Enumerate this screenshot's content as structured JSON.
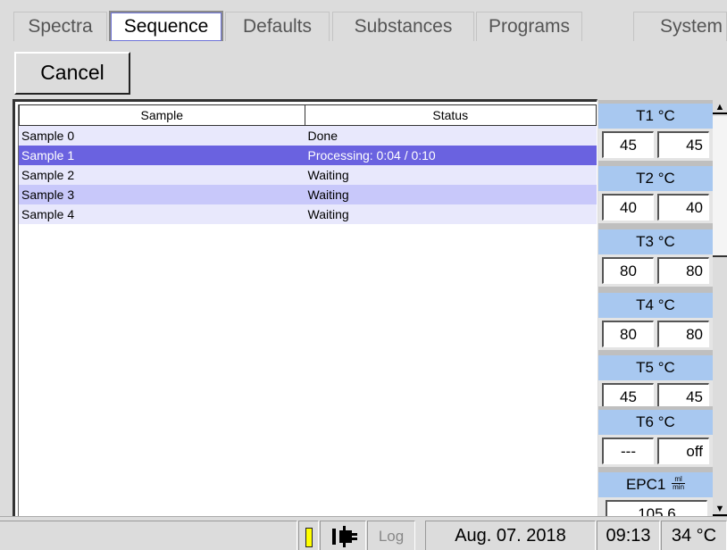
{
  "tabs": [
    {
      "label": "Spectra",
      "active": false
    },
    {
      "label": "Sequence",
      "active": true
    },
    {
      "label": "Defaults",
      "active": false
    },
    {
      "label": "Substances",
      "active": false
    },
    {
      "label": "Programs",
      "active": false
    },
    {
      "label": "System",
      "active": false
    }
  ],
  "toolbar": {
    "cancel_label": "Cancel"
  },
  "table": {
    "columns": [
      "Sample",
      "Status"
    ],
    "rows": [
      {
        "sample": "Sample 0",
        "status": "Done",
        "state": "light"
      },
      {
        "sample": "Sample 1",
        "status": "Processing: 0:04 / 0:10",
        "state": "selected"
      },
      {
        "sample": "Sample 2",
        "status": "Waiting",
        "state": "light"
      },
      {
        "sample": "Sample 3",
        "status": "Waiting",
        "state": "medium"
      },
      {
        "sample": "Sample 4",
        "status": "Waiting",
        "state": "light"
      }
    ]
  },
  "panel": {
    "groups": [
      {
        "label": "T1 °C",
        "value1": "45",
        "value2": "45"
      },
      {
        "label": "T2 °C",
        "value1": "40",
        "value2": "40"
      },
      {
        "label": "T3 °C",
        "value1": "80",
        "value2": "80"
      },
      {
        "label": "T4 °C",
        "value1": "80",
        "value2": "80"
      },
      {
        "label": "T5 °C",
        "value1": "45",
        "value2": "45"
      },
      {
        "label": "T6 °C",
        "value1": "---",
        "value2": "off"
      },
      {
        "label": "EPC1",
        "unit_num": "ml",
        "unit_den": "min",
        "value1": "105.6"
      }
    ]
  },
  "statusbar": {
    "log_label": "Log",
    "date": "Aug. 07. 2018",
    "time": "09:13",
    "temperature": "34 °C",
    "indicator_color": "#ffff00"
  },
  "icons": {
    "plug": "plug-icon",
    "indicator": "level-indicator-icon"
  },
  "colors": {
    "selected_row": "#6a62e0",
    "light_row": "#e8e8fc",
    "medium_row": "#c8c8fa",
    "panel_header": "#a8c8f0"
  }
}
